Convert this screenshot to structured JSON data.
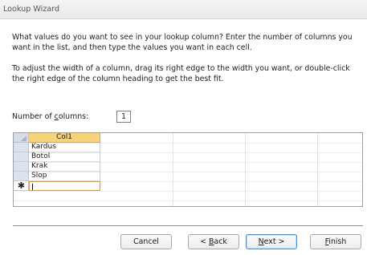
{
  "window": {
    "title": "Lookup Wizard"
  },
  "instructions": {
    "p1": "What values do you want to see in your lookup column? Enter the number of columns you want in the list, and then type the values you want in each cell.",
    "p2": "To adjust the width of a column, drag its right edge to the width you want, or double-click the right edge of the column heading to get the best fit."
  },
  "columns_field": {
    "label_pre": "Number of ",
    "label_u": "c",
    "label_post": "olumns:",
    "value": "1"
  },
  "grid": {
    "column_header": "Col1",
    "rows": [
      "Kardus",
      "Botol",
      "Krak",
      "Slop"
    ],
    "new_row_marker": "✱",
    "new_row_value": ""
  },
  "buttons": {
    "cancel": "Cancel",
    "back_pre": "< ",
    "back_u": "B",
    "back_post": "ack",
    "next_u": "N",
    "next_post": "ext >",
    "finish_u": "F",
    "finish_post": "inish"
  }
}
